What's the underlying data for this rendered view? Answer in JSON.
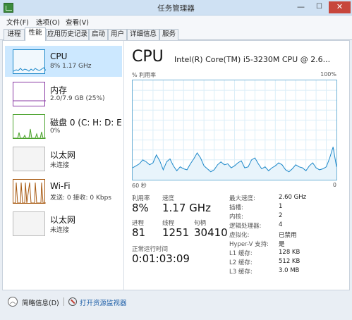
{
  "window": {
    "title": "任务管理器",
    "minimize": "—",
    "maximize": "☐",
    "close": "✕"
  },
  "menu": [
    "文件(F)",
    "选项(O)",
    "查看(V)"
  ],
  "tabs": [
    "进程",
    "性能",
    "应用历史记录",
    "启动",
    "用户",
    "详细信息",
    "服务"
  ],
  "active_tab": "性能",
  "sidebar": {
    "items": [
      {
        "name": "CPU",
        "detail": "8% 1.17 GHz",
        "color": "#1b87c9"
      },
      {
        "name": "内存",
        "detail": "2.0/7.9 GB (25%)",
        "color": "#8b3ba5"
      },
      {
        "name": "磁盘 0 (C: H: D: E",
        "detail": "0%",
        "color": "#4da32f"
      },
      {
        "name": "以太网",
        "detail": "未连接",
        "color": "#a0a0a0"
      },
      {
        "name": "Wi-Fi",
        "detail": "发送: 0 接收: 0 Kbps",
        "color": "#a85a12"
      },
      {
        "name": "以太网",
        "detail": "未连接",
        "color": "#a0a0a0"
      }
    ]
  },
  "cpu": {
    "title": "CPU",
    "model": "Intel(R) Core(TM) i5-3230M CPU @ 2.6...",
    "graph_label_left": "% 利用率",
    "graph_label_right": "100%",
    "axis_left": "60 秒",
    "axis_right": "0",
    "utilization_label": "利用率",
    "utilization": "8%",
    "speed_label": "速度",
    "speed": "1.17 GHz",
    "processes_label": "进程",
    "processes": "81",
    "threads_label": "线程",
    "threads": "1251",
    "handles_label": "句柄",
    "handles": "30410",
    "uptime_label": "正常运行时间",
    "uptime": "0:01:03:09",
    "specs": [
      {
        "label": "最大速度:",
        "value": "2.60 GHz"
      },
      {
        "label": "插槽:",
        "value": "1"
      },
      {
        "label": "内核:",
        "value": "2"
      },
      {
        "label": "逻辑处理器:",
        "value": "4"
      },
      {
        "label": "虚拟化:",
        "value": "已禁用"
      },
      {
        "label": "Hyper-V 支持:",
        "value": "是"
      },
      {
        "label": "L1 缓存:",
        "value": "128 KB"
      },
      {
        "label": "L2 缓存:",
        "value": "512 KB"
      },
      {
        "label": "L3 缓存:",
        "value": "3.0 MB"
      }
    ],
    "history": [
      12,
      14,
      16,
      20,
      18,
      15,
      17,
      25,
      19,
      10,
      18,
      21,
      14,
      9,
      13,
      11,
      10,
      16,
      21,
      27,
      22,
      14,
      11,
      8,
      10,
      15,
      18,
      15,
      16,
      12,
      14,
      17,
      19,
      12,
      13,
      20,
      22,
      16,
      11,
      13,
      9,
      12,
      14,
      17,
      15,
      10,
      8,
      11,
      15,
      13,
      12,
      9,
      14,
      17,
      12,
      10,
      11,
      13,
      22,
      33,
      13
    ]
  },
  "footer": {
    "fewer_details": "简略信息(D)",
    "resource_monitor": "打开资源监视器"
  }
}
